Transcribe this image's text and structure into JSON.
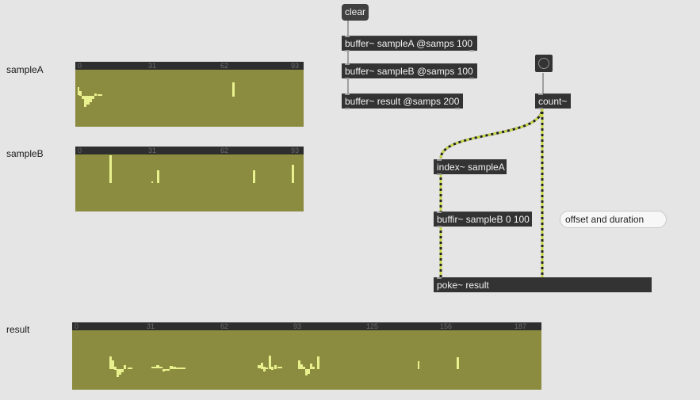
{
  "labels": {
    "sampleA": "sampleA",
    "sampleB": "sampleB",
    "result": "result"
  },
  "waveforms": {
    "sampleA": {
      "ticks": [
        "0",
        "31",
        "62",
        "93"
      ]
    },
    "sampleB": {
      "ticks": [
        "0",
        "31",
        "62",
        "93"
      ]
    },
    "result": {
      "ticks": [
        "0",
        "31",
        "62",
        "93",
        "125",
        "156",
        "187"
      ]
    }
  },
  "objects": {
    "clear": "clear",
    "bufferA": "buffer~ sampleA @samps 100",
    "bufferB": "buffer~ sampleB @samps 100",
    "bufferResult": "buffer~ result @samps 200",
    "count": "count~",
    "index": "index~ sampleA",
    "buffir": "buffir~ sampleB 0 100",
    "poke": "poke~ result"
  },
  "comment": "offset and duration",
  "colors": {
    "background": "#e5e5e5",
    "waveform_bg": "#8c8c40",
    "waveform_fg": "#e9f18f",
    "object_bg": "#333333",
    "signal_cord": "#c9d84a"
  }
}
